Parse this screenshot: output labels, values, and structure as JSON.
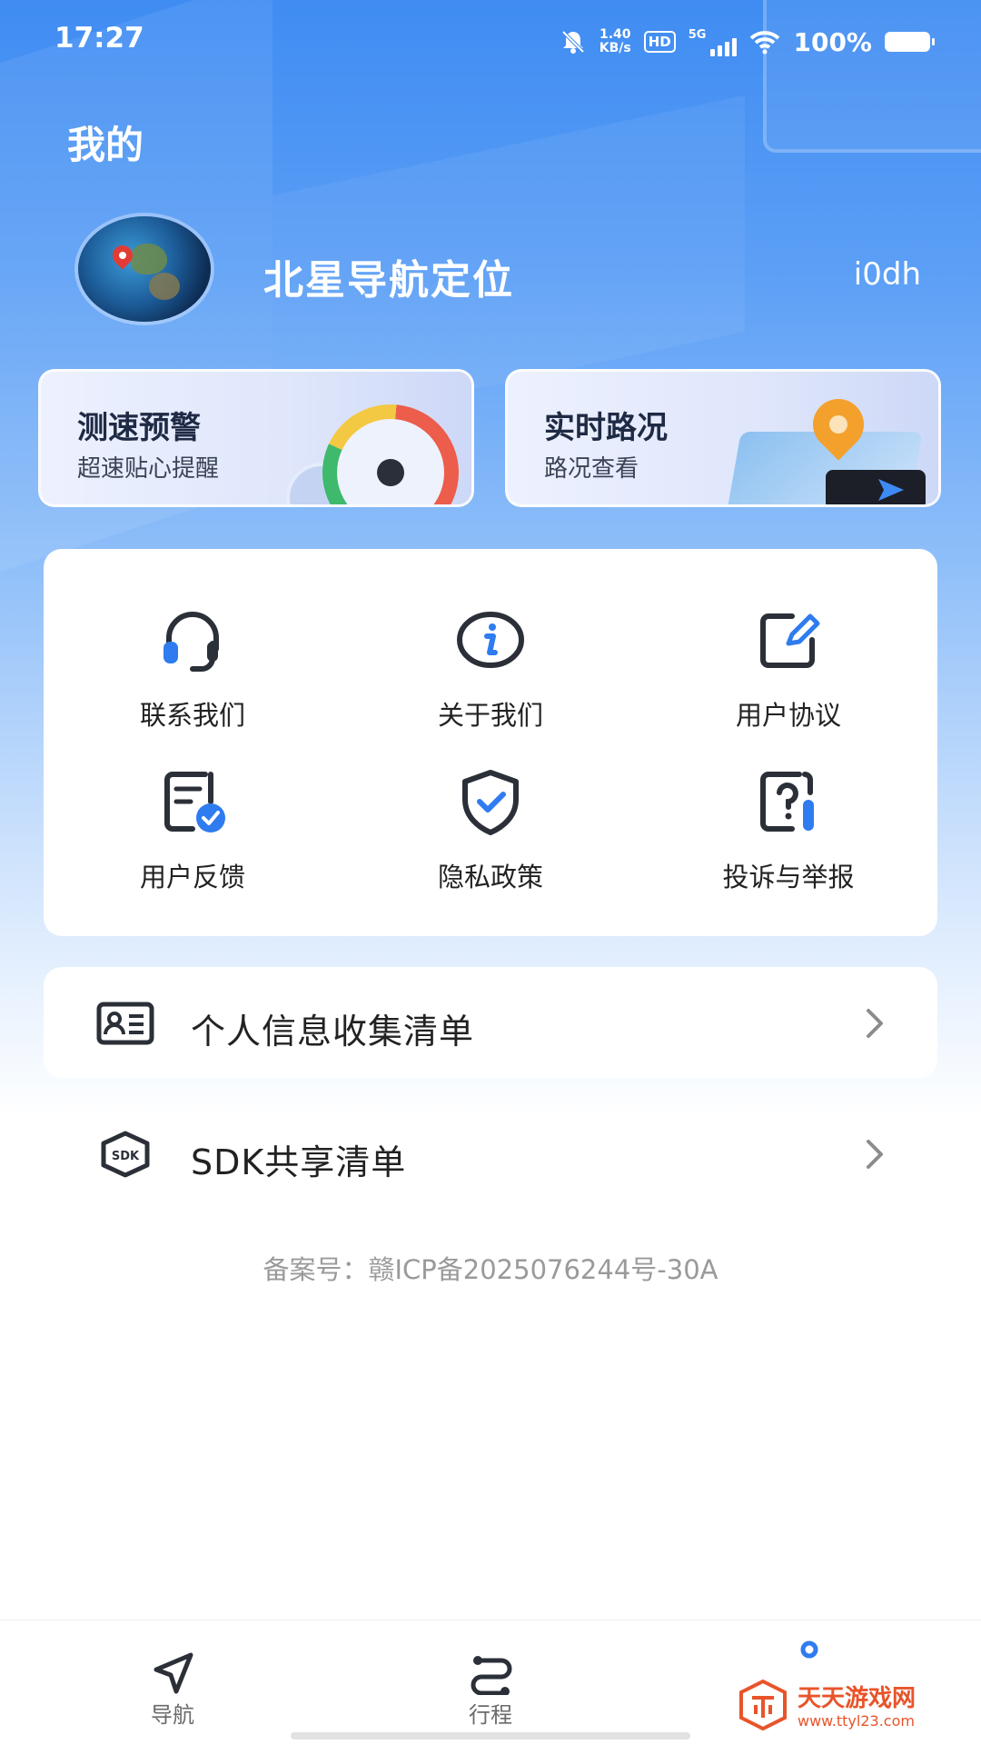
{
  "status_bar": {
    "time": "17:27",
    "net_speed_value": "1.40",
    "net_speed_unit": "KB/s",
    "hd": "HD",
    "network": "5G",
    "battery": "100%"
  },
  "page_title": "我的",
  "profile": {
    "app_name": "北星导航定位",
    "user_id": "i0dh"
  },
  "promo_cards": [
    {
      "title": "测速预警",
      "subtitle": "超速贴心提醒"
    },
    {
      "title": "实时路况",
      "subtitle": "路况查看"
    }
  ],
  "grid": [
    {
      "label": "联系我们",
      "icon": "headset-icon"
    },
    {
      "label": "关于我们",
      "icon": "info-icon"
    },
    {
      "label": "用户协议",
      "icon": "edit-document-icon"
    },
    {
      "label": "用户反馈",
      "icon": "feedback-document-icon"
    },
    {
      "label": "隐私政策",
      "icon": "shield-check-icon"
    },
    {
      "label": "投诉与举报",
      "icon": "question-report-icon"
    }
  ],
  "list": [
    {
      "label": "个人信息收集清单",
      "icon": "id-card-icon"
    },
    {
      "label": "SDK共享清单",
      "icon": "sdk-box-icon"
    }
  ],
  "icp_text": "备案号：赣ICP备2025076244号-30A",
  "bottom_nav": [
    {
      "label": "导航",
      "icon": "navigation-arrow-icon"
    },
    {
      "label": "行程",
      "icon": "route-icon"
    },
    {
      "label": "",
      "icon": "profile-icon"
    }
  ],
  "watermark": {
    "title": "天天游戏网",
    "url": "www.ttyl23.com"
  },
  "colors": {
    "primary_blue": "#3f8cf2",
    "accent_blue": "#2f7bf0",
    "watermark_orange": "#e8542a"
  }
}
